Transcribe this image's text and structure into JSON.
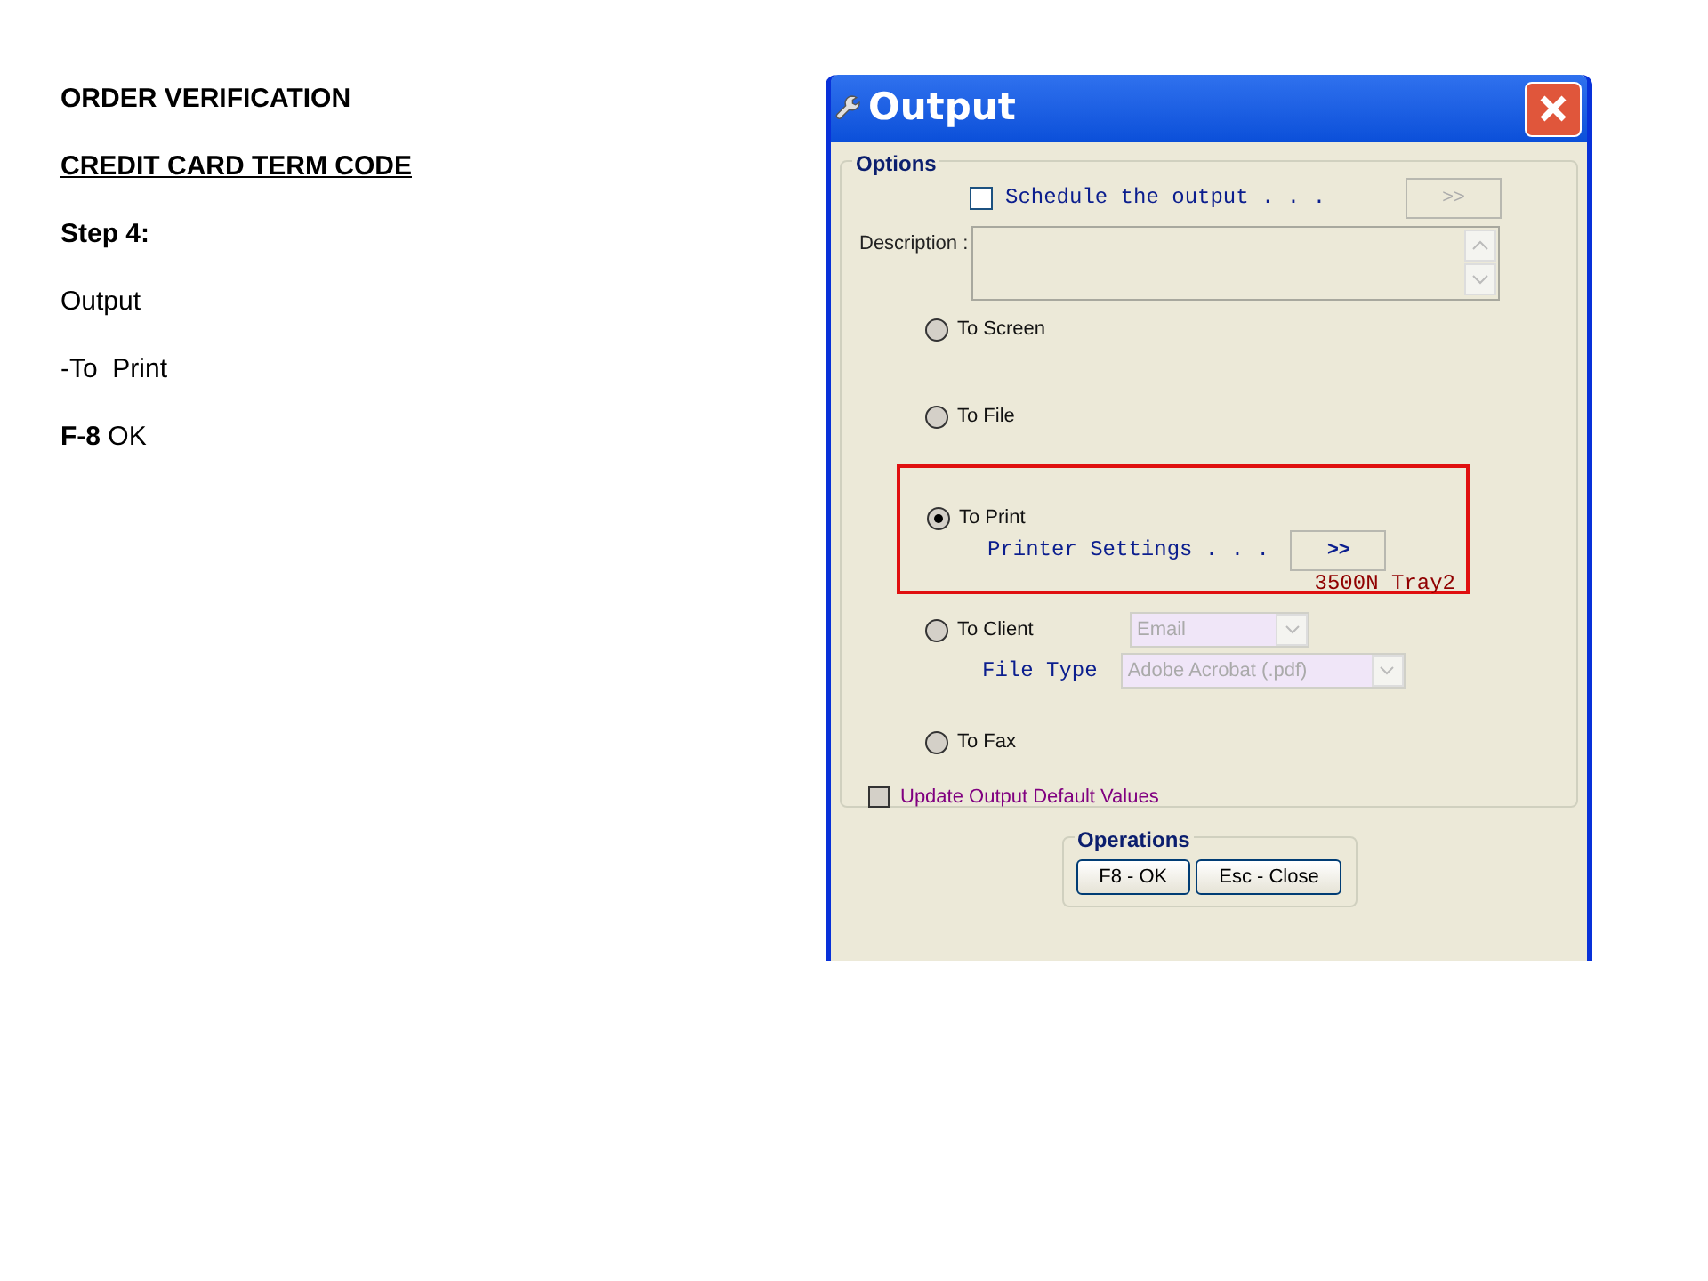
{
  "notes": [
    {
      "kind": "bold",
      "text": "ORDER VERIFICATION"
    },
    {
      "kind": "underline",
      "text": "CREDIT CARD TERM CODE"
    },
    {
      "kind": "bold",
      "text": "Step 4:"
    },
    {
      "kind": "plain",
      "text": "Output"
    },
    {
      "kind": "plain",
      "text": "-To  Print"
    },
    {
      "kind": "rich",
      "text": "**F-8** OK"
    }
  ],
  "window": {
    "title": "Output"
  },
  "options": {
    "title": "Options",
    "schedule": {
      "label": "Schedule the output . . .",
      "checked": false,
      "button": ">>"
    },
    "description": {
      "label": "Description :"
    },
    "destinations": [
      {
        "kind": "plain",
        "label": "To Screen",
        "selected": false
      },
      {
        "kind": "plain",
        "label": "To File",
        "selected": false
      },
      {
        "kind": "print",
        "label": "To Print",
        "selected": true,
        "highlighted": true,
        "settings_label": "Printer Settings . . .",
        "settings_button": ">>",
        "printer": "3500N Tray2"
      },
      {
        "kind": "client",
        "label": "To Client",
        "selected": false,
        "method": "Email",
        "file_type_label": "File Type",
        "file_type": "Adobe Acrobat (.pdf)"
      },
      {
        "kind": "plain",
        "label": "To Fax",
        "selected": false
      }
    ],
    "update_defaults": {
      "label": "Update Output Default Values",
      "checked": false
    }
  },
  "operations": {
    "title": "Operations",
    "buttons": [
      "F8 - OK",
      "Esc - Close"
    ]
  }
}
